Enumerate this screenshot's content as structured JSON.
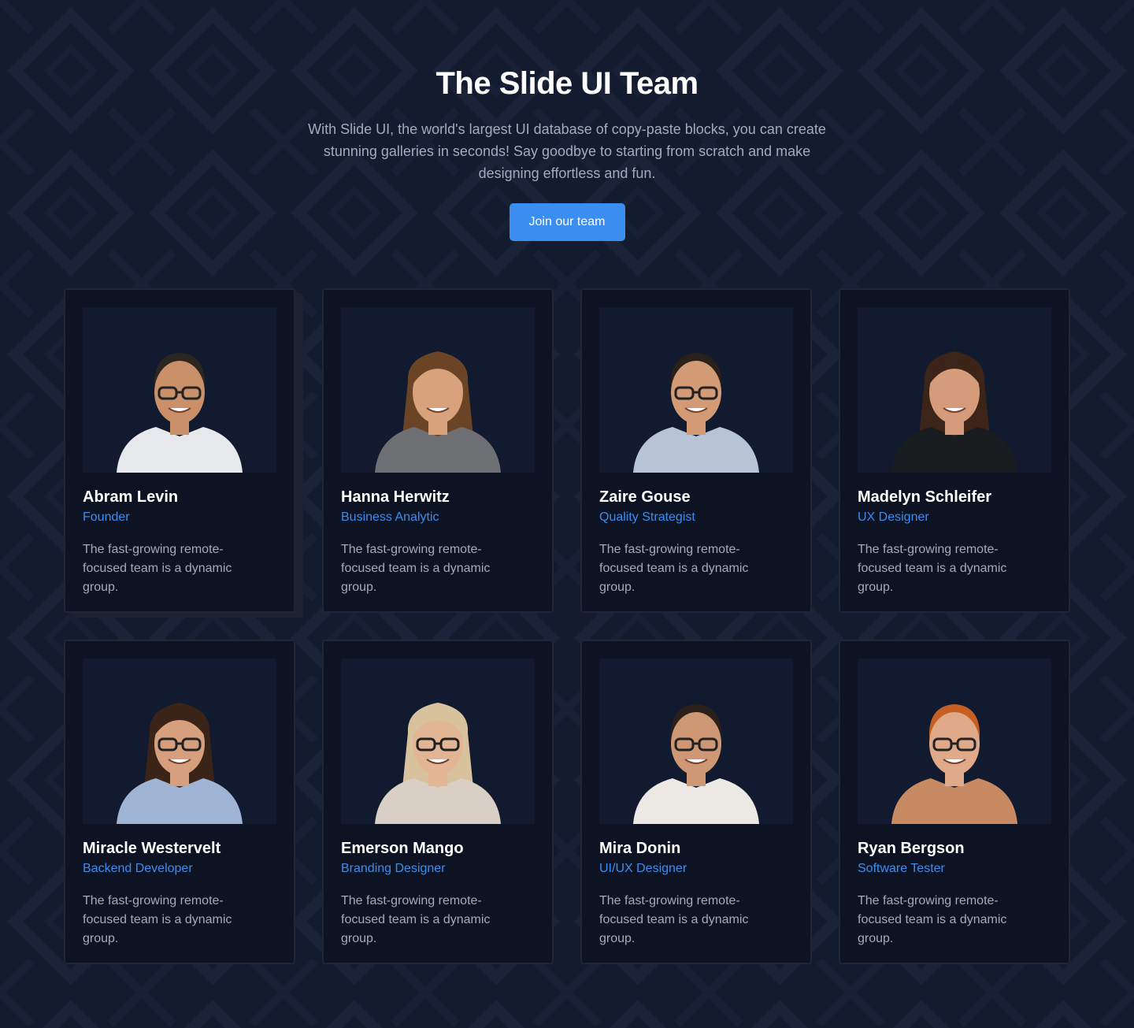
{
  "hero": {
    "title": "The Slide UI Team",
    "description": "With Slide UI, the world's largest UI database of copy-paste blocks, you can create stunning galleries in seconds! Say goodbye to starting from scratch and make designing effortless and fun.",
    "cta_label": "Join our team"
  },
  "colors": {
    "background": "#131b2e",
    "card": "#0d1323",
    "accent": "#3b8ef0",
    "muted_text": "#a3abbb"
  },
  "team": [
    {
      "name": "Abram Levin",
      "role": "Founder",
      "bio": "The fast-growing remote-focused team is a dynamic group.",
      "shirt": "#e6e8ec",
      "hair": "#2b2622",
      "skin": "#c9906a",
      "glasses": true,
      "long_hair": false
    },
    {
      "name": "Hanna Herwitz",
      "role": "Business Analytic",
      "bio": "The fast-growing remote-focused team is a dynamic group.",
      "shirt": "#6e6f72",
      "hair": "#6b4426",
      "skin": "#d7a27c",
      "glasses": false,
      "long_hair": true
    },
    {
      "name": "Zaire Gouse",
      "role": "Quality Strategist",
      "bio": "The fast-growing remote-focused team is a dynamic group.",
      "shirt": "#b6c4d6",
      "hair": "#2a201a",
      "skin": "#d29b76",
      "glasses": true,
      "long_hair": false
    },
    {
      "name": "Madelyn Schleifer",
      "role": "UX Designer",
      "bio": "The fast-growing remote-focused team is a dynamic group.",
      "shirt": "#1a1d1f",
      "hair": "#3c2418",
      "skin": "#d49c7a",
      "glasses": false,
      "long_hair": true
    },
    {
      "name": "Miracle Westervelt",
      "role": "Backend Developer",
      "bio": "The fast-growing remote-focused team is a dynamic group.",
      "shirt": "#9fb4d4",
      "hair": "#3a2418",
      "skin": "#d6a07e",
      "glasses": true,
      "long_hair": true
    },
    {
      "name": "Emerson Mango",
      "role": "Branding Designer",
      "bio": "The fast-growing remote-focused team is a dynamic group.",
      "shirt": "#d9cfc4",
      "hair": "#d8c29e",
      "skin": "#e2b595",
      "glasses": true,
      "long_hair": true
    },
    {
      "name": "Mira Donin",
      "role": "UI/UX Designer",
      "bio": "The fast-growing remote-focused team is a dynamic group.",
      "shirt": "#ece9e4",
      "hair": "#2a1f19",
      "skin": "#cf9875",
      "glasses": true,
      "long_hair": false
    },
    {
      "name": "Ryan Bergson",
      "role": "Software Tester",
      "bio": "The fast-growing remote-focused team is a dynamic group.",
      "shirt": "#c78a63",
      "hair": "#c75f22",
      "skin": "#e0a98a",
      "glasses": true,
      "long_hair": false
    }
  ]
}
